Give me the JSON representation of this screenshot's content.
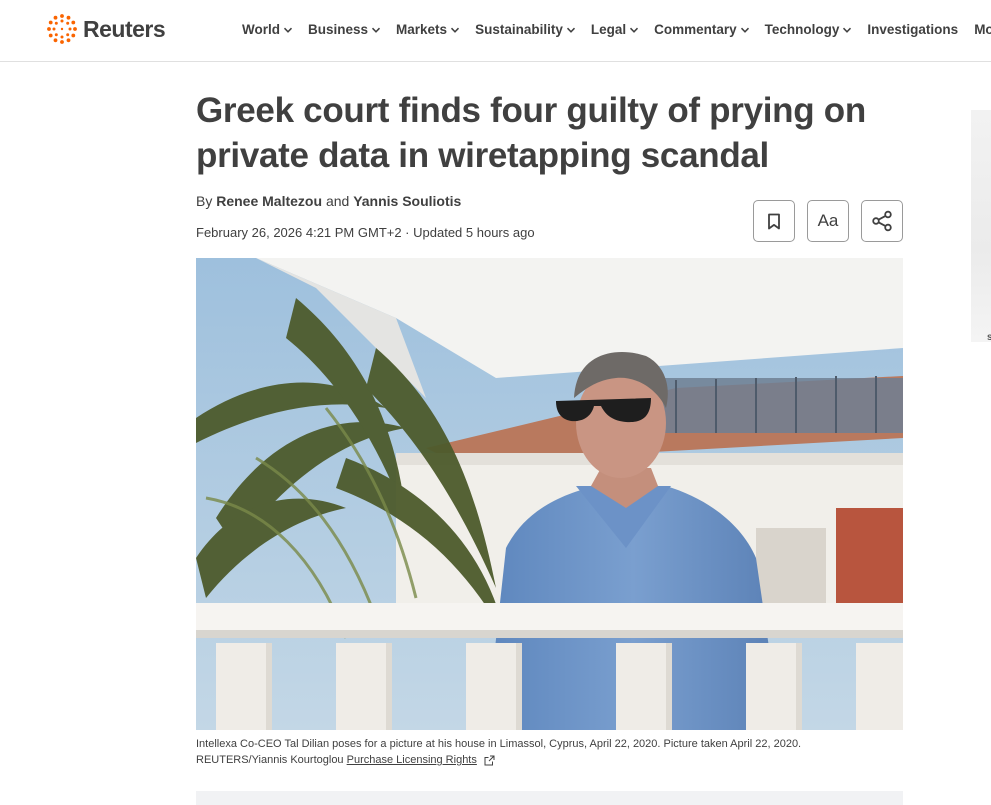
{
  "brand": {
    "name": "Reuters",
    "accent": "#fa6400"
  },
  "nav": {
    "items": [
      {
        "label": "World",
        "has_menu": true
      },
      {
        "label": "Business",
        "has_menu": true
      },
      {
        "label": "Markets",
        "has_menu": true
      },
      {
        "label": "Sustainability",
        "has_menu": true
      },
      {
        "label": "Legal",
        "has_menu": true
      },
      {
        "label": "Commentary",
        "has_menu": true
      },
      {
        "label": "Technology",
        "has_menu": true
      },
      {
        "label": "Investigations",
        "has_menu": false
      },
      {
        "label": "More",
        "has_menu": true
      }
    ]
  },
  "article": {
    "headline": "Greek court finds four guilty of prying on private data in wiretapping scandal",
    "by_prefix": "By",
    "author1": "Renee Maltezou",
    "and": "and",
    "author2": "Yannis Souliotis",
    "dateline": "February 26, 2026 4:21 PM GMT+2 · Updated 5 hours ago",
    "tools": {
      "bookmark_icon": "bookmark-icon",
      "font_size_label": "Aa",
      "share_icon": "share-icon"
    },
    "photo": {
      "caption": "Intellexa Co-CEO Tal Dilian poses for a picture at his house in Limassol, Cyprus, April 22, 2020. Picture taken April 22, 2020.",
      "credit": "REUTERS/Yiannis Kourtoglou",
      "license_link": "Purchase Licensing Rights"
    }
  },
  "rail": {
    "fragment": "s"
  }
}
